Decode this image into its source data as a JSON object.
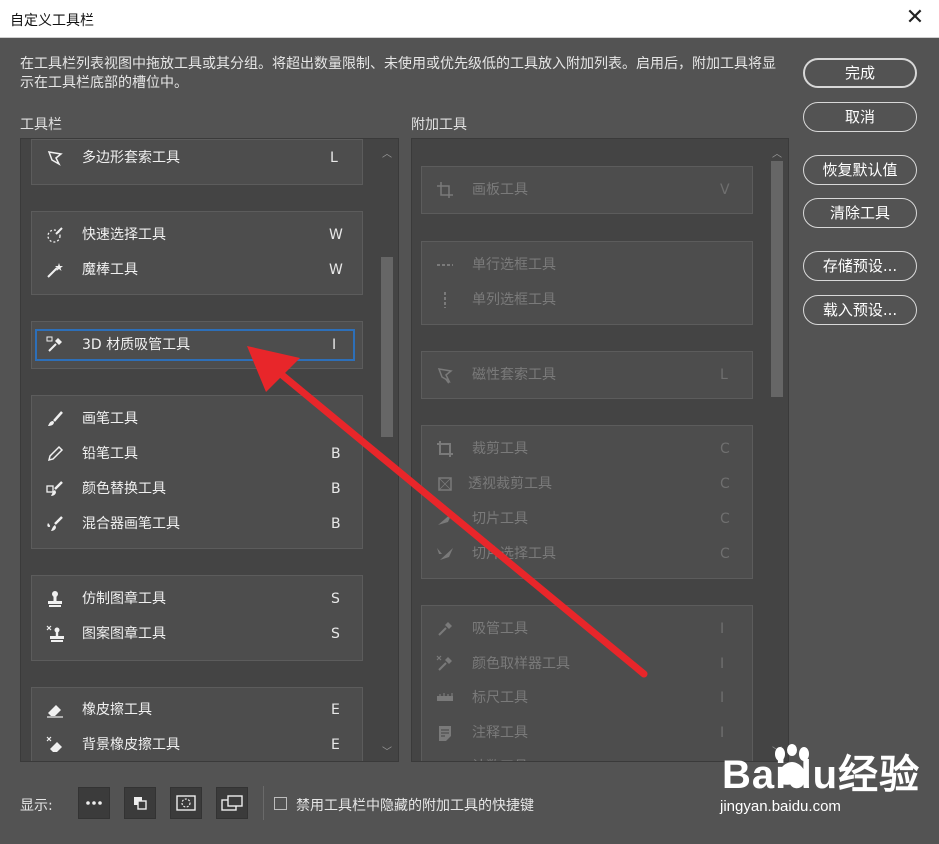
{
  "window": {
    "title": "自定义工具栏",
    "close_glyph": "✕"
  },
  "description": "在工具栏列表视图中拖放工具或其分组。将超出数量限制、未使用或优先级低的工具放入附加列表。启用后，附加工具将显示在工具栏底部的槽位中。",
  "toolbar_label": "工具栏",
  "extra_label": "附加工具",
  "toolbar_groups": [
    {
      "items": [
        {
          "name": "多边形套索工具",
          "key": "L",
          "icon": "polygon-lasso-icon"
        }
      ]
    },
    {
      "items": [
        {
          "name": "快速选择工具",
          "key": "W",
          "icon": "quick-select-icon"
        },
        {
          "name": "魔棒工具",
          "key": "W",
          "icon": "magic-wand-icon"
        }
      ]
    },
    {
      "items": [
        {
          "name": "3D 材质吸管工具",
          "key": "I",
          "icon": "3d-eyedropper-icon"
        }
      ]
    },
    {
      "items": [
        {
          "name": "画笔工具",
          "key": "",
          "icon": "brush-icon"
        },
        {
          "name": "铅笔工具",
          "key": "B",
          "icon": "pencil-icon"
        },
        {
          "name": "颜色替换工具",
          "key": "B",
          "icon": "color-replace-icon"
        },
        {
          "name": "混合器画笔工具",
          "key": "B",
          "icon": "mixer-brush-icon"
        }
      ]
    },
    {
      "items": [
        {
          "name": "仿制图章工具",
          "key": "S",
          "icon": "clone-stamp-icon"
        },
        {
          "name": "图案图章工具",
          "key": "S",
          "icon": "pattern-stamp-icon"
        }
      ]
    },
    {
      "items": [
        {
          "name": "橡皮擦工具",
          "key": "E",
          "icon": "eraser-icon"
        },
        {
          "name": "背景橡皮擦工具",
          "key": "E",
          "icon": "background-eraser-icon"
        }
      ]
    }
  ],
  "extra_groups": [
    {
      "items": [
        {
          "name": "画板工具",
          "key": "V",
          "icon": "artboard-icon"
        }
      ]
    },
    {
      "items": [
        {
          "name": "单行选框工具",
          "key": "",
          "icon": "single-row-marquee-icon"
        },
        {
          "name": "单列选框工具",
          "key": "",
          "icon": "single-column-marquee-icon"
        }
      ]
    },
    {
      "items": [
        {
          "name": "磁性套索工具",
          "key": "L",
          "icon": "magnetic-lasso-icon"
        }
      ]
    },
    {
      "items": [
        {
          "name": "裁剪工具",
          "key": "C",
          "icon": "crop-icon"
        },
        {
          "name": "透视裁剪工具",
          "key": "C",
          "icon": "perspective-crop-icon"
        },
        {
          "name": "切片工具",
          "key": "C",
          "icon": "slice-icon"
        },
        {
          "name": "切片选择工具",
          "key": "C",
          "icon": "slice-select-icon"
        }
      ]
    },
    {
      "items": [
        {
          "name": "吸管工具",
          "key": "I",
          "icon": "eyedropper-icon"
        },
        {
          "name": "颜色取样器工具",
          "key": "I",
          "icon": "color-sampler-icon"
        },
        {
          "name": "标尺工具",
          "key": "I",
          "icon": "ruler-icon"
        },
        {
          "name": "注释工具",
          "key": "I",
          "icon": "note-icon"
        },
        {
          "name": "计数工具",
          "key": "",
          "icon": "count-icon"
        }
      ]
    }
  ],
  "buttons": {
    "done": "完成",
    "cancel": "取消",
    "restore_defaults": "恢复默认值",
    "clear_tools": "清除工具",
    "save_preset": "存储预设...",
    "load_preset": "载入预设..."
  },
  "bottom": {
    "show_label": "显示:",
    "checkbox_label": "禁用工具栏中隐藏的附加工具的快捷键"
  },
  "watermark": {
    "brand": "Baidu经验",
    "url": "jingyan.baidu.com"
  },
  "colors": {
    "annotation_arrow": "#e8262a",
    "dialog_bg": "#535353",
    "selected_outline": "#2d6fb8"
  }
}
